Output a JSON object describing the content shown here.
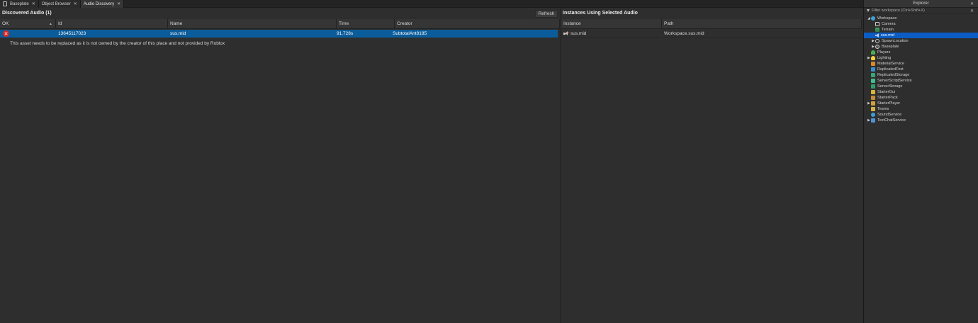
{
  "tabs": [
    {
      "label": "Baseplate",
      "active": false
    },
    {
      "label": "Object Browser",
      "active": false
    },
    {
      "label": "Audio Discovery",
      "active": true
    }
  ],
  "left": {
    "title": "Discovered Audio (1)",
    "refresh_label": "Refresh",
    "columns": [
      "OK",
      "Id",
      "Name",
      "Time",
      "Creator"
    ],
    "rows": [
      {
        "status": "error",
        "id": "13645117023",
        "name": "sus.mid",
        "time": "91.728s",
        "creator": "SubtotalAnt8185"
      }
    ],
    "warning": "This asset needs to be replaced as it is not owned by the creator of this place and not provided by Roblox"
  },
  "instances": {
    "title": "Instances Using Selected Audio",
    "columns": [
      "Instance",
      "Path"
    ],
    "rows": [
      {
        "instance": "sus.mid",
        "path": "Workspace.sus.mid"
      }
    ]
  },
  "explorer": {
    "title": "Explorer",
    "filter_placeholder": "Filter workspace (Ctrl+Shift+X)",
    "items": [
      {
        "label": "Workspace",
        "icon": "world-icon",
        "level": 0,
        "arrow": "expanded"
      },
      {
        "label": "Camera",
        "icon": "camera-icon",
        "level": 1,
        "arrow": "none"
      },
      {
        "label": "Terrain",
        "icon": "terrain-icon",
        "level": 1,
        "arrow": "none"
      },
      {
        "label": "sus.mid",
        "icon": "sound-icon",
        "level": 1,
        "arrow": "none",
        "selected": true
      },
      {
        "label": "SpawnLocation",
        "icon": "spawn-icon",
        "level": 1,
        "arrow": "collapsed"
      },
      {
        "label": "Baseplate",
        "icon": "part-icon",
        "level": 1,
        "arrow": "collapsed"
      },
      {
        "label": "Players",
        "icon": "players-icon",
        "level": 0,
        "arrow": "none"
      },
      {
        "label": "Lighting",
        "icon": "lighting-icon",
        "level": 0,
        "arrow": "collapsed"
      },
      {
        "label": "MaterialService",
        "icon": "material-icon",
        "level": 0,
        "arrow": "none"
      },
      {
        "label": "ReplicatedFirst",
        "icon": "replicated-first-icon",
        "level": 0,
        "arrow": "none"
      },
      {
        "label": "ReplicatedStorage",
        "icon": "replicated-storage-icon",
        "level": 0,
        "arrow": "none"
      },
      {
        "label": "ServerScriptService",
        "icon": "server-script-icon",
        "level": 0,
        "arrow": "none"
      },
      {
        "label": "ServerStorage",
        "icon": "server-storage-icon",
        "level": 0,
        "arrow": "none"
      },
      {
        "label": "StarterGui",
        "icon": "starter-gui-icon",
        "level": 0,
        "arrow": "none"
      },
      {
        "label": "StarterPack",
        "icon": "starter-pack-icon",
        "level": 0,
        "arrow": "none"
      },
      {
        "label": "StarterPlayer",
        "icon": "starter-player-icon",
        "level": 0,
        "arrow": "collapsed"
      },
      {
        "label": "Teams",
        "icon": "teams-icon",
        "level": 0,
        "arrow": "none"
      },
      {
        "label": "SoundService",
        "icon": "sound-service-icon",
        "level": 0,
        "arrow": "none"
      },
      {
        "label": "TextChatService",
        "icon": "text-chat-icon",
        "level": 0,
        "arrow": "collapsed"
      }
    ]
  },
  "colors": {
    "selection": "#0b5c9a",
    "explorer_selection": "#0b5cc4",
    "error": "#e02424",
    "panel": "#2e2e2e"
  }
}
